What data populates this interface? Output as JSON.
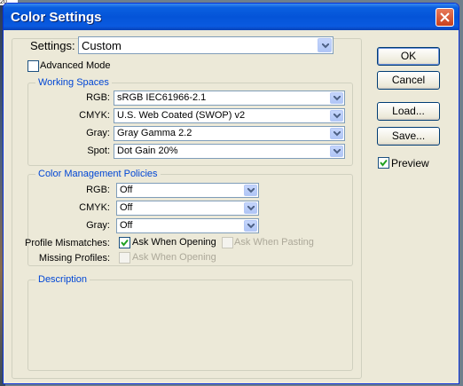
{
  "window": {
    "title": "Color Settings"
  },
  "settings": {
    "label": "Settings:",
    "value": "Custom"
  },
  "advanced_mode": {
    "label": "Advanced Mode",
    "checked": false
  },
  "working_spaces": {
    "legend": "Working Spaces",
    "rows": [
      {
        "label": "RGB:",
        "value": "sRGB IEC61966-2.1"
      },
      {
        "label": "CMYK:",
        "value": "U.S. Web Coated (SWOP) v2"
      },
      {
        "label": "Gray:",
        "value": "Gray Gamma 2.2"
      },
      {
        "label": "Spot:",
        "value": "Dot Gain 20%"
      }
    ]
  },
  "policies": {
    "legend": "Color Management Policies",
    "rows": [
      {
        "label": "RGB:",
        "value": "Off"
      },
      {
        "label": "CMYK:",
        "value": "Off"
      },
      {
        "label": "Gray:",
        "value": "Off"
      }
    ],
    "profile_mismatches": {
      "label": "Profile Mismatches:",
      "ask_opening": "Ask When Opening",
      "ask_pasting": "Ask When Pasting"
    },
    "missing_profiles": {
      "label": "Missing Profiles:",
      "ask_opening": "Ask When Opening"
    }
  },
  "description": {
    "legend": "Description",
    "text": ""
  },
  "buttons": {
    "ok": "OK",
    "cancel": "Cancel",
    "load": "Load...",
    "save": "Save..."
  },
  "preview": {
    "label": "Preview",
    "checked": true
  },
  "colors": {
    "titlebar": "#0454d8",
    "accent_text": "#0046d5",
    "dialog_bg": "#ece9d8"
  }
}
